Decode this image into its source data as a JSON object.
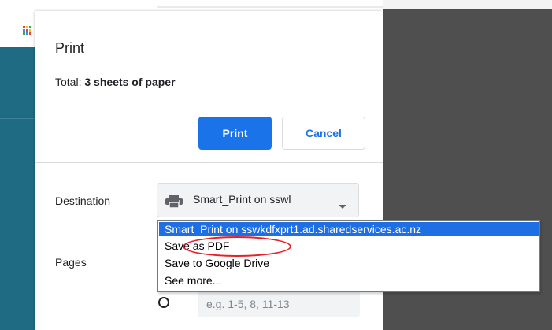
{
  "colors": {
    "accent": "#1a73e8",
    "dropdown_selected": "#1e6ee4",
    "highlight_ring": "#e4202a",
    "side_panel": "#1f6b83",
    "preview_area": "#4f4f4f"
  },
  "dialog": {
    "title": "Print",
    "total_prefix": "Total: ",
    "total_value": "3 sheets of paper",
    "print_label": "Print",
    "cancel_label": "Cancel"
  },
  "settings": {
    "destination_label": "Destination",
    "destination_value": "Smart_Print on sswl",
    "destination_icon": "printer-icon",
    "pages_label": "Pages",
    "custom_pages_placeholder": "e.g. 1-5, 8, 11-13"
  },
  "dropdown": {
    "options": [
      "Smart_Print on sswkdfxprt1.ad.sharedservices.ac.nz",
      "Save as PDF",
      "Save to Google Drive",
      "See more..."
    ],
    "selected_index": 0,
    "circled_option": "Save as PDF"
  }
}
